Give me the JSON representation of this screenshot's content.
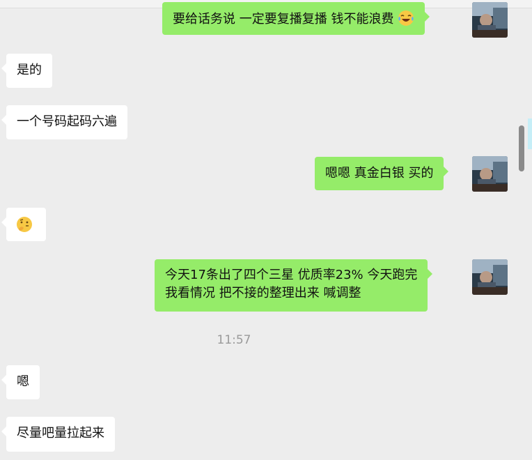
{
  "messages": [
    {
      "side": "right",
      "text": "要给话务说  一定要复播复播   钱不能浪费",
      "emoji": "laughing-tears"
    },
    {
      "side": "left",
      "text": "是的"
    },
    {
      "side": "left",
      "text": "一个号码起码六遍"
    },
    {
      "side": "right",
      "text": "嗯嗯  真金白银 买的"
    },
    {
      "side": "left",
      "text": "",
      "emoji": "thinking-face"
    },
    {
      "side": "right",
      "line1": "今天17条出了四个三星  优质率23%  今天跑完",
      "line2": "我看情况 把不接的整理出来 喊调整"
    },
    {
      "side": "left",
      "text": "嗯"
    },
    {
      "side": "left",
      "text": "尽量吧量拉起来"
    }
  ],
  "timestamp": "11:57",
  "colors": {
    "background": "#ededed",
    "outgoing_bubble": "#95ec69",
    "incoming_bubble": "#ffffff",
    "timestamp": "#9a9a9a"
  }
}
